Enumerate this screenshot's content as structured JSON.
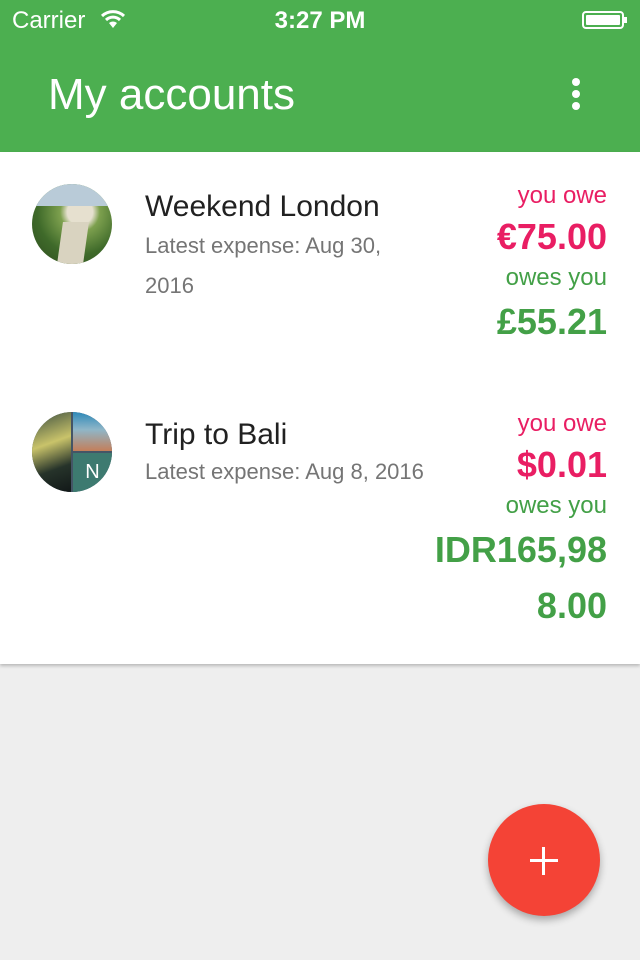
{
  "status_bar": {
    "carrier": "Carrier",
    "time": "3:27 PM",
    "wifi_icon": "wifi-icon",
    "battery_icon": "battery-icon"
  },
  "app_bar": {
    "title": "My accounts",
    "menu_icon": "more-vert-icon",
    "color": "#4caf50"
  },
  "accounts": [
    {
      "name": "Weekend London",
      "latest_expense": "Latest expense: Aug 30, 2016",
      "you_owe_label": "you owe",
      "you_owe_amount": "€75.00",
      "owes_you_label": "owes you",
      "owes_you_amount": "£55.21"
    },
    {
      "name": "Trip to Bali",
      "latest_expense": "Latest expense: Aug 8, 2016",
      "you_owe_label": "you owe",
      "you_owe_amount": "$0.01",
      "owes_you_label": "owes you",
      "owes_you_amount": "IDR165,988.00",
      "avatar_initial": "N"
    }
  ],
  "fab": {
    "icon": "add-icon",
    "color": "#f44336"
  },
  "colors": {
    "owe": "#e91e63",
    "owed": "#43a047"
  }
}
